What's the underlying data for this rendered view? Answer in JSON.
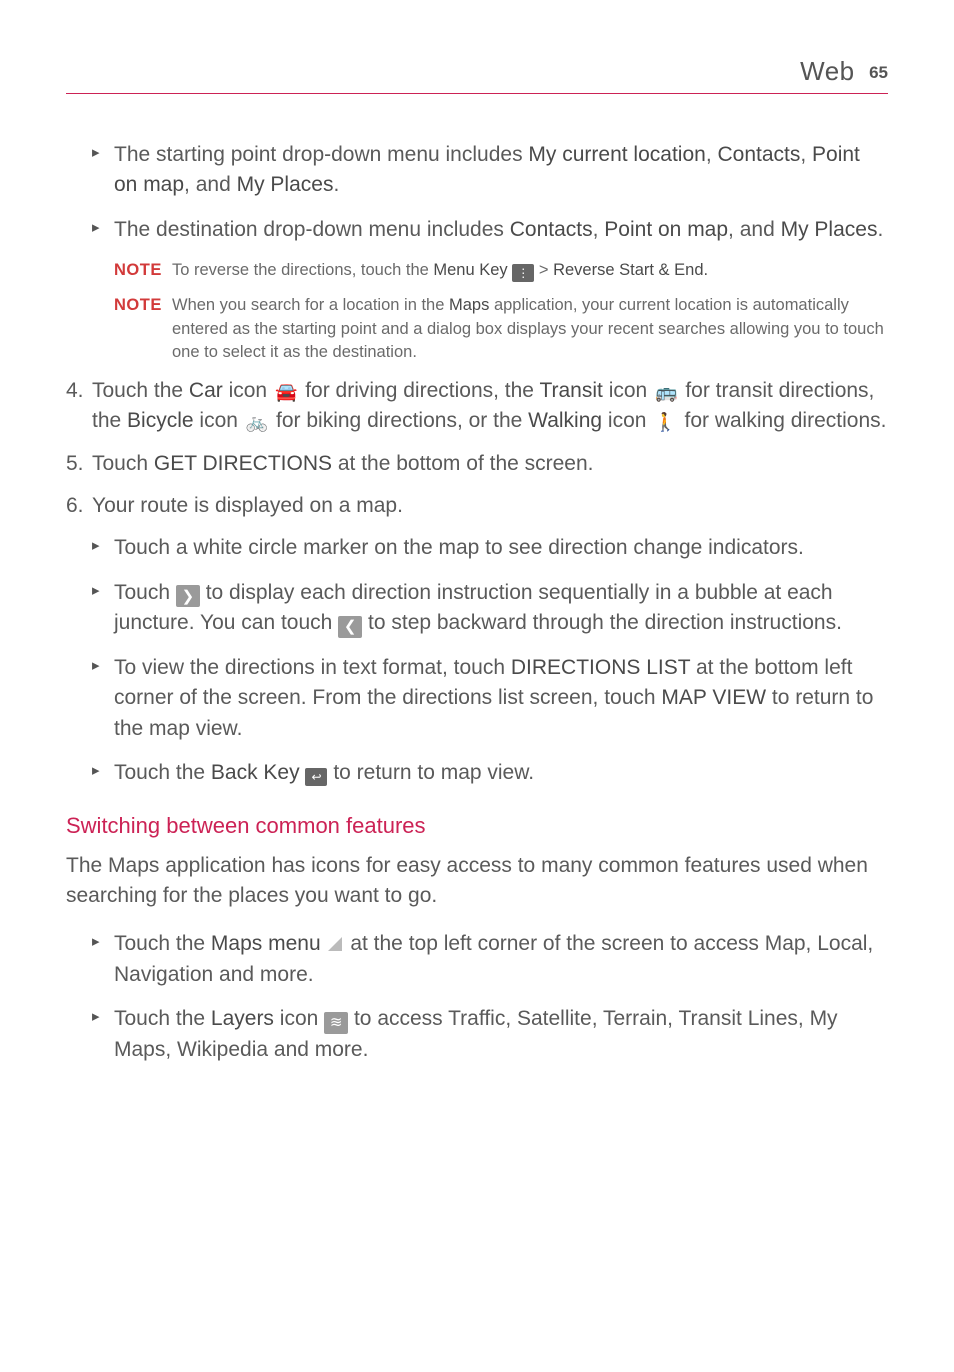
{
  "header": {
    "section": "Web",
    "page": "65"
  },
  "topBullets": [
    {
      "pre": "The starting point drop-down menu includes ",
      "bold1": "My current location",
      "mid1": ", ",
      "bold2": "Contacts",
      "mid2": ", ",
      "bold3": "Point on map",
      "mid3": ", and ",
      "bold4": "My Places",
      "post": "."
    },
    {
      "pre": "The destination drop-down menu includes ",
      "bold1": "Contacts",
      "mid1": ", ",
      "bold2": "Point on map",
      "mid2": ", and ",
      "bold3": "My Places",
      "post": "."
    }
  ],
  "note1": {
    "tag": "NOTE",
    "pre": "To reverse the directions, touch the ",
    "b1": "Menu Key",
    "mid": " > ",
    "b2": "Reverse Start & End."
  },
  "note2": {
    "tag": "NOTE",
    "pre": "When you search for a location in the ",
    "b1": "Maps",
    "post": " application, your current location is automatically entered as the starting point and a dialog box displays your recent searches allowing you to touch one to select it as the destination."
  },
  "step4": {
    "num": "4.",
    "t1": "Touch the ",
    "b1": "Car",
    "t2": " icon ",
    "t3": " for driving directions, the ",
    "b2": "Transit",
    "t4": " icon ",
    "t5": " for transit directions, the ",
    "b3": "Bicycle",
    "t6": " icon ",
    "t7": " for biking directions, or the ",
    "b4": "Walking",
    "t8": " icon ",
    "t9": " for walking directions."
  },
  "step5": {
    "num": "5.",
    "t1": "Touch ",
    "b1": "GET DIRECTIONS",
    "t2": " at the bottom of the screen."
  },
  "step6": {
    "num": "6.",
    "t1": "Your route is displayed on a map."
  },
  "subBullets": [
    {
      "text": "Touch a white circle marker on the map to see direction change indicators."
    },
    {
      "t1": "Touch ",
      "t2": " to display each direction instruction sequentially in a bubble at each juncture. You can touch ",
      "t3": " to step backward through the direction instructions."
    },
    {
      "t1": "To view the directions in text format, touch ",
      "b1": "DIRECTIONS LIST",
      "t2": " at the bottom left corner of the screen. From the directions list screen, touch ",
      "b2": "MAP VIEW",
      "t3": " to return to the map view."
    },
    {
      "t1": "Touch the ",
      "b1": "Back Key",
      "t2": " to return to map view."
    }
  ],
  "subheading": "Switching between common features",
  "para": "The Maps application has icons for easy access to many common features used when searching for the places you want to go.",
  "bottomBullets": [
    {
      "t1": "Touch the ",
      "b1": "Maps menu",
      "t2": " at the top left corner of the screen to access Map, Local, Navigation and more."
    },
    {
      "t1": "Touch the ",
      "b1": "Layers",
      "t2": " icon ",
      "t3": " to access Traffic, Satellite, Terrain, Transit Lines, My Maps, Wikipedia and more."
    }
  ]
}
